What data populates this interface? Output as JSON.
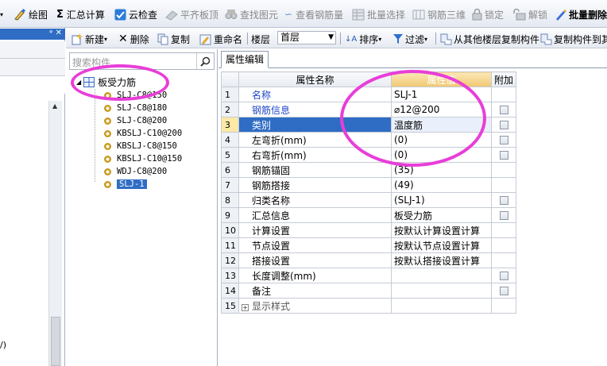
{
  "toolbar_main": {
    "draw": "绘图",
    "sum": "汇总计算",
    "cloud_check": "云检查",
    "flush_slab": "平齐板顶",
    "find_element": "查找图元",
    "view_rebar_amount": "查看钢筋量",
    "batch_select": "批量选择",
    "rebar_3d": "钢筋三维",
    "lock": "锁定",
    "unlock": "解锁",
    "batch_delete": "批量删除"
  },
  "toolbar_secondary": {
    "new": "新建",
    "delete": "删除",
    "copy": "复制",
    "rename": "重命名",
    "floor_label": "楼层",
    "floor_value": "首层",
    "sort": "排序",
    "filter": "过滤",
    "copy_from_other_floor": "从其他楼层复制构件",
    "copy_to_other_floor": "复制构件到其"
  },
  "left_strip": {
    "bottom_text": "/)"
  },
  "tree": {
    "search_placeholder": "搜索构件...",
    "root_label": "板受力筋",
    "items": [
      {
        "label": "SLJ-C8@150"
      },
      {
        "label": "SLJ-C8@180"
      },
      {
        "label": "SLJ-C8@200"
      },
      {
        "label": "KBSLJ-C10@200"
      },
      {
        "label": "KBSLJ-C8@150"
      },
      {
        "label": "KBSLJ-C10@150"
      },
      {
        "label": "WDJ-C8@200"
      },
      {
        "label": "SLJ-1"
      }
    ]
  },
  "props": {
    "tab": "属性编辑",
    "columns": {
      "name": "属性名称",
      "value": "属性值",
      "extra": "附加"
    },
    "rows": [
      {
        "num": "1",
        "name": "名称",
        "value": "SLJ-1"
      },
      {
        "num": "2",
        "name": "钢筋信息",
        "value": "⌀12@200"
      },
      {
        "num": "3",
        "name": "类别",
        "value": "温度筋"
      },
      {
        "num": "4",
        "name": "左弯折(mm)",
        "value": "(0)"
      },
      {
        "num": "5",
        "name": "右弯折(mm)",
        "value": "(0)"
      },
      {
        "num": "6",
        "name": "钢筋锚固",
        "value": "(35)"
      },
      {
        "num": "7",
        "name": "钢筋搭接",
        "value": "(49)"
      },
      {
        "num": "8",
        "name": "归类名称",
        "value": "(SLJ-1)"
      },
      {
        "num": "9",
        "name": "汇总信息",
        "value": "板受力筋"
      },
      {
        "num": "10",
        "name": "计算设置",
        "value": "按默认计算设置计算"
      },
      {
        "num": "11",
        "name": "节点设置",
        "value": "按默认节点设置计算"
      },
      {
        "num": "12",
        "name": "搭接设置",
        "value": "按默认搭接设置计算"
      },
      {
        "num": "13",
        "name": "长度调整(mm)",
        "value": ""
      },
      {
        "num": "14",
        "name": "备注",
        "value": ""
      },
      {
        "num": "15",
        "name": "显示样式",
        "value": ""
      }
    ]
  },
  "colors": {
    "selection": "#2f6dc5",
    "annotation": "#e83ed8",
    "header_value": "#f0c873"
  }
}
